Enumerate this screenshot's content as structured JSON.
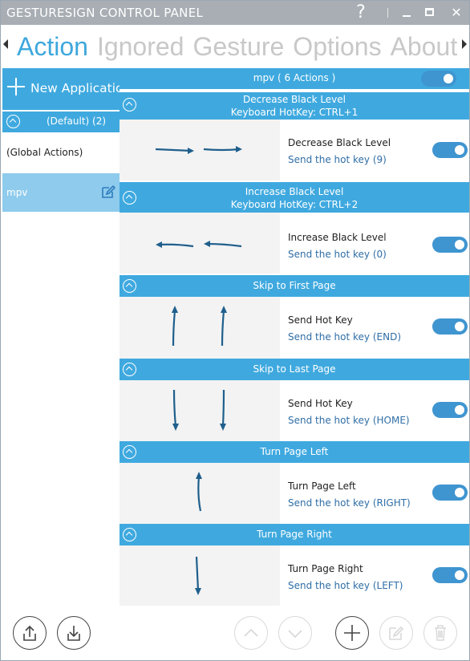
{
  "window": {
    "title": "GESTURESIGN CONTROL PANEL",
    "help_glyph": "?",
    "close_glyph": "✕"
  },
  "tabs": [
    {
      "label": "Action",
      "active": true
    },
    {
      "label": "Ignored",
      "active": false
    },
    {
      "label": "Gesture",
      "active": false
    },
    {
      "label": "Options",
      "active": false
    },
    {
      "label": "About",
      "active": false
    }
  ],
  "sidebar": {
    "new_application_label": "New Application",
    "group_label": "(Default) (2)",
    "apps": [
      {
        "label": "(Global Actions)",
        "selected": false
      },
      {
        "label": "mpv",
        "selected": true
      }
    ]
  },
  "main": {
    "app_header": "mpv   ( 6 Actions )",
    "app_enabled": true,
    "actions": [
      {
        "title": "Decrease Black Level",
        "hotkey": "Keyboard HotKey: CTRL+1",
        "name": "Decrease Black Level",
        "command": "Send the hot key (9)",
        "enabled": true,
        "gesture": "right-right"
      },
      {
        "title": "Increase Black Level",
        "hotkey": "Keyboard HotKey: CTRL+2",
        "name": "Increase Black Level",
        "command": "Send the hot key (0)",
        "enabled": true,
        "gesture": "left-left"
      },
      {
        "title": "Skip to First Page",
        "hotkey": "",
        "name": "Send Hot Key",
        "command": "Send the hot key (END)",
        "enabled": true,
        "gesture": "up-up"
      },
      {
        "title": "Skip to Last Page",
        "hotkey": "",
        "name": "Send Hot Key",
        "command": "Send the hot key (HOME)",
        "enabled": true,
        "gesture": "down-down"
      },
      {
        "title": "Turn Page Left",
        "hotkey": "",
        "name": "Turn Page Left",
        "command": "Send the hot key (RIGHT)",
        "enabled": true,
        "gesture": "up"
      },
      {
        "title": "Turn Page Right",
        "hotkey": "",
        "name": "Turn Page Right",
        "command": "Send the hot key (LEFT)",
        "enabled": true,
        "gesture": "down"
      }
    ]
  },
  "toolbar": {
    "buttons": [
      {
        "name": "export-button",
        "icon": "upload-icon",
        "enabled": true
      },
      {
        "name": "import-button",
        "icon": "download-icon",
        "enabled": true
      },
      {
        "name": "move-up-button",
        "icon": "chevron-up-icon",
        "enabled": false
      },
      {
        "name": "move-down-button",
        "icon": "chevron-down-icon",
        "enabled": false
      },
      {
        "name": "add-action-button",
        "icon": "plus-icon",
        "enabled": true
      },
      {
        "name": "edit-action-button",
        "icon": "edit-icon",
        "enabled": false
      },
      {
        "name": "delete-action-button",
        "icon": "trash-icon",
        "enabled": false
      }
    ]
  },
  "colors": {
    "accent": "#3fa9df",
    "selected": "#8ecbec",
    "toggle": "#3f95d0",
    "link": "#2f6ea6",
    "titlebar": "#a8aeb3"
  }
}
